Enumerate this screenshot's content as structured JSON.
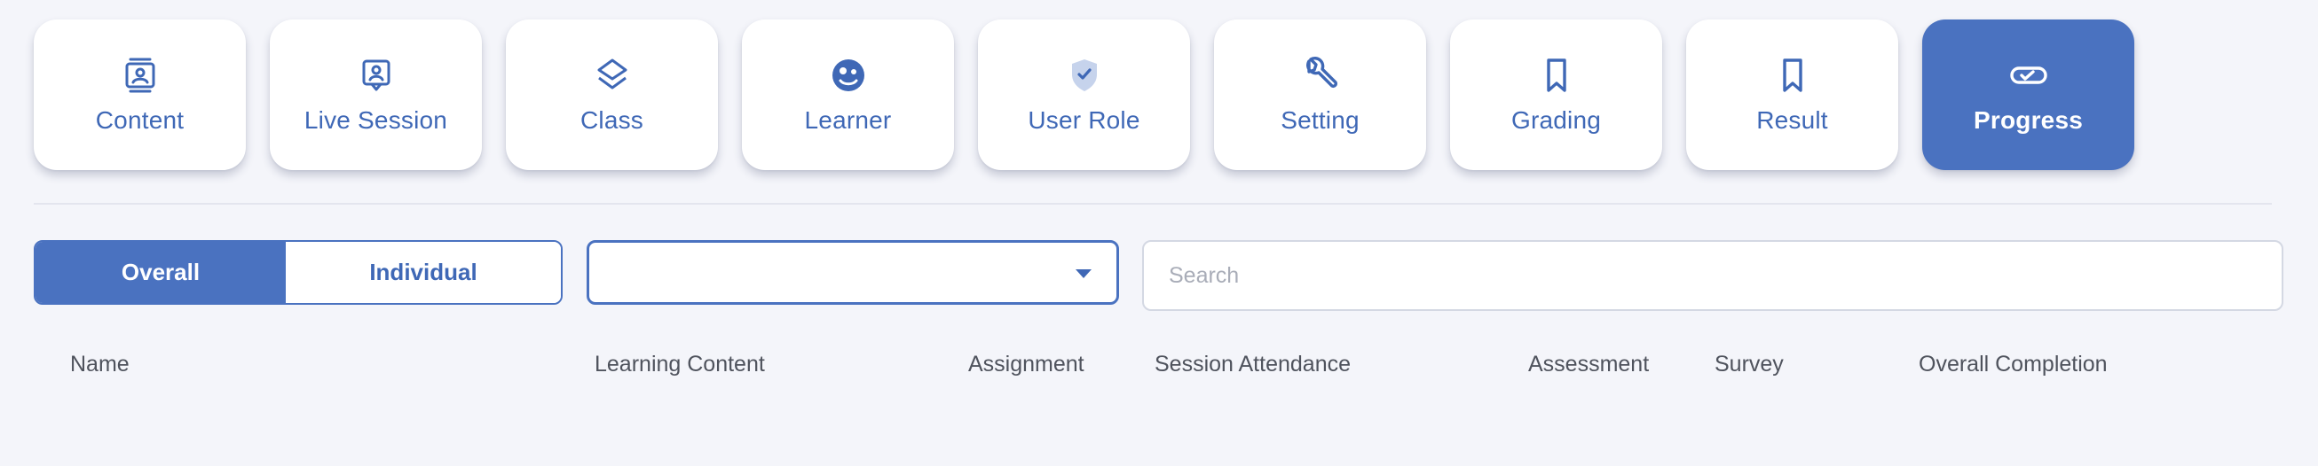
{
  "tabs": [
    {
      "label": "Content",
      "icon": "contact-card-icon",
      "active": false
    },
    {
      "label": "Live Session",
      "icon": "live-presenter-icon",
      "active": false
    },
    {
      "label": "Class",
      "icon": "layers-icon",
      "active": false
    },
    {
      "label": "Learner",
      "icon": "learner-face-icon",
      "active": false
    },
    {
      "label": "User Role",
      "icon": "shield-check-icon",
      "active": false
    },
    {
      "label": "Setting",
      "icon": "wrench-icon",
      "active": false
    },
    {
      "label": "Grading",
      "icon": "bookmark-icon",
      "active": false
    },
    {
      "label": "Result",
      "icon": "bookmark-icon",
      "active": false
    },
    {
      "label": "Progress",
      "icon": "progress-pill-icon",
      "active": true
    }
  ],
  "view_toggle": {
    "overall": "Overall",
    "individual": "Individual",
    "selected": "Overall"
  },
  "filter_select": {
    "value": ""
  },
  "search": {
    "placeholder": "Search",
    "value": ""
  },
  "table": {
    "headers": [
      "Name",
      "Learning Content",
      "Assignment",
      "Session Attendance",
      "Assessment",
      "Survey",
      "Overall Completion"
    ]
  },
  "colors": {
    "accent": "#4a72c0",
    "accent_text": "#3f68b6",
    "background": "#f4f5fa"
  }
}
